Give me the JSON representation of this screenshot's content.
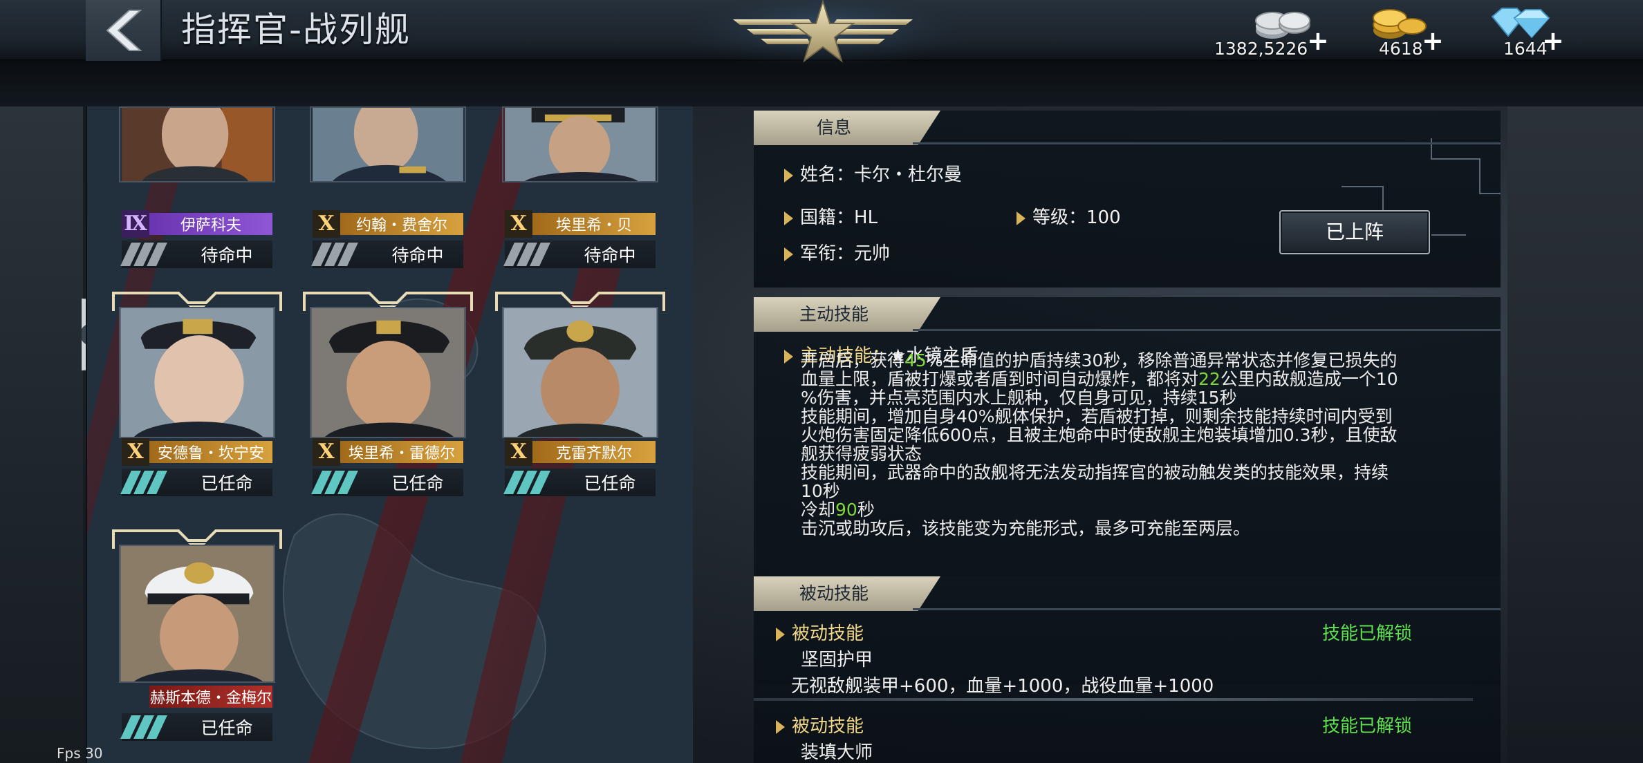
{
  "header": {
    "title": "指挥官-战列舰",
    "back_label": "back"
  },
  "currencies": [
    {
      "name": "silver-coins",
      "amount": "1382,5226",
      "plus": "+"
    },
    {
      "name": "gold-coins",
      "amount": "4618",
      "plus": "+"
    },
    {
      "name": "diamonds",
      "amount": "1644",
      "plus": "+"
    }
  ],
  "roster": [
    {
      "rank": "Ⅸ",
      "name": "伊萨科夫",
      "status": "待命中",
      "rank_color": "#7b3fc0",
      "assigned": false
    },
    {
      "rank": "X",
      "name": "约翰・费舍尔",
      "status": "待命中",
      "rank_color": "#d2962f",
      "assigned": false
    },
    {
      "rank": "X",
      "name": "埃里希・贝",
      "status": "待命中",
      "rank_color": "#d2962f",
      "assigned": false
    },
    {
      "rank": "X",
      "name": "安德鲁・坎宁安",
      "status": "已任命",
      "rank_color": "#d2962f",
      "assigned": true
    },
    {
      "rank": "X",
      "name": "埃里希・雷德尔",
      "status": "已任命",
      "rank_color": "#d2962f",
      "assigned": true
    },
    {
      "rank": "X",
      "name": "克雷齐默尔",
      "status": "已任命",
      "rank_color": "#d2962f",
      "assigned": true
    },
    {
      "rank": "",
      "name": "赫斯本德・金梅尔",
      "status": "已任命",
      "rank_color": "#b0302a",
      "assigned": true
    }
  ],
  "info": {
    "section_title": "信息",
    "name_label": "姓名：",
    "name_value": "卡尔・杜尔曼",
    "nation_label": "国籍：",
    "nation_value": "HL",
    "level_label": "等级：",
    "level_value": "100",
    "rank_label": "军衔：",
    "rank_value": "元帅",
    "deploy_button": "已上阵"
  },
  "active_skill": {
    "section_title": "主动技能",
    "label": "主动技能：",
    "name": "★水镜之盾",
    "line1_a": "开启后，获得",
    "line1_hl": "45",
    "line1_b": "%生命值的护盾持续30秒，移除普通异常状态并修复已损失的",
    "line2_a": "血量上限，盾被打爆或者盾到时间自动爆炸，都将对",
    "line2_hl": "22",
    "line2_b": "公里内敌舰造成一个10",
    "line3": "%伤害，并点亮范围内水上舰种，仅自身可见，持续15秒",
    "line4": "技能期间，增加自身40%舰体保护，若盾被打掉，则剩余技能持续时间内受到",
    "line5": "火炮伤害固定降低600点，且被主炮命中时使敌舰主炮装填增加0.3秒，且使敌",
    "line6": "舰获得疲弱状态",
    "line7": "技能期间，武器命中的敌舰将无法发动指挥官的被动触发类的技能效果，持续",
    "line8": "10秒",
    "line9_a": "冷却",
    "line9_hl": "90",
    "line9_b": "秒",
    "line10": "击沉或助攻后，该技能变为充能形式，最多可充能至两层。"
  },
  "passive_skill": {
    "section_title": "被动技能",
    "entries": [
      {
        "label": "被动技能",
        "state": "技能已解锁",
        "name": "坚固护甲",
        "desc": "无视敌舰装甲+600，血量+1000，战役血量+1000"
      },
      {
        "label": "被动技能",
        "state": "技能已解锁",
        "name": "装填大师",
        "desc": ""
      }
    ]
  },
  "fps": "Fps 30"
}
